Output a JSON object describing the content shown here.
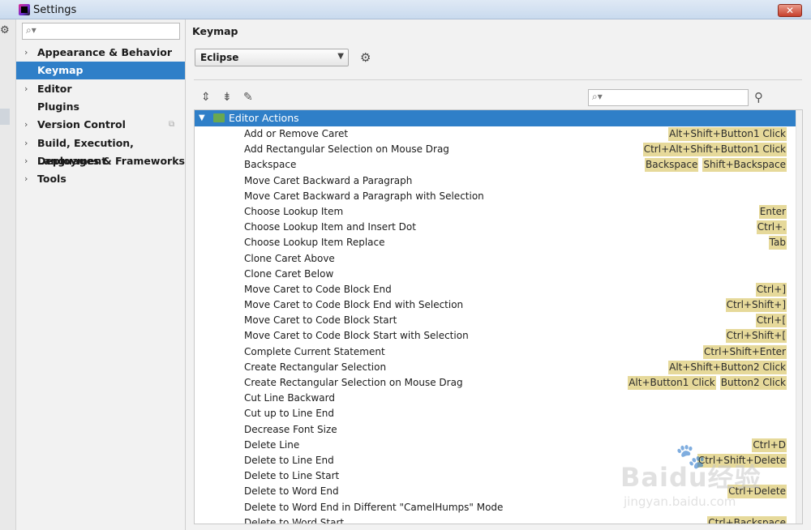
{
  "window": {
    "title": "Settings",
    "close_glyph": "✕"
  },
  "left": {
    "search_placeholder": "",
    "items": [
      {
        "label": "Appearance & Behavior",
        "chevron": "›"
      },
      {
        "label": "Keymap",
        "chevron": ""
      },
      {
        "label": "Editor",
        "chevron": "›"
      },
      {
        "label": "Plugins",
        "chevron": ""
      },
      {
        "label": "Version Control",
        "chevron": "›"
      },
      {
        "label": "Build, Execution, Deployment",
        "chevron": "›"
      },
      {
        "label": "Languages & Frameworks",
        "chevron": "›"
      },
      {
        "label": "Tools",
        "chevron": "›"
      }
    ],
    "selected_index": 1
  },
  "main": {
    "title": "Keymap",
    "scheme": "Eclipse",
    "group": "Editor Actions",
    "actions": [
      {
        "name": "Add or Remove Caret",
        "keys": [
          "Alt+Shift+Button1 Click"
        ]
      },
      {
        "name": "Add Rectangular Selection on Mouse Drag",
        "keys": [
          "Ctrl+Alt+Shift+Button1 Click"
        ]
      },
      {
        "name": "Backspace",
        "keys": [
          "Backspace",
          "Shift+Backspace"
        ]
      },
      {
        "name": "Move Caret Backward a Paragraph",
        "keys": []
      },
      {
        "name": "Move Caret Backward a Paragraph with Selection",
        "keys": []
      },
      {
        "name": "Choose Lookup Item",
        "keys": [
          "Enter"
        ]
      },
      {
        "name": "Choose Lookup Item and Insert Dot",
        "keys": [
          "Ctrl+."
        ]
      },
      {
        "name": "Choose Lookup Item Replace",
        "keys": [
          "Tab"
        ]
      },
      {
        "name": "Clone Caret Above",
        "keys": []
      },
      {
        "name": "Clone Caret Below",
        "keys": []
      },
      {
        "name": "Move Caret to Code Block End",
        "keys": [
          "Ctrl+]"
        ]
      },
      {
        "name": "Move Caret to Code Block End with Selection",
        "keys": [
          "Ctrl+Shift+]"
        ]
      },
      {
        "name": "Move Caret to Code Block Start",
        "keys": [
          "Ctrl+["
        ]
      },
      {
        "name": "Move Caret to Code Block Start with Selection",
        "keys": [
          "Ctrl+Shift+["
        ]
      },
      {
        "name": "Complete Current Statement",
        "keys": [
          "Ctrl+Shift+Enter"
        ]
      },
      {
        "name": "Create Rectangular Selection",
        "keys": [
          "Alt+Shift+Button2 Click"
        ]
      },
      {
        "name": "Create Rectangular Selection on Mouse Drag",
        "keys": [
          "Alt+Button1 Click",
          "Button2 Click"
        ]
      },
      {
        "name": "Cut Line Backward",
        "keys": []
      },
      {
        "name": "Cut up to Line End",
        "keys": []
      },
      {
        "name": "Decrease Font Size",
        "keys": []
      },
      {
        "name": "Delete Line",
        "keys": [
          "Ctrl+D"
        ]
      },
      {
        "name": "Delete to Line End",
        "keys": [
          "Ctrl+Shift+Delete"
        ]
      },
      {
        "name": "Delete to Line Start",
        "keys": []
      },
      {
        "name": "Delete to Word End",
        "keys": [
          "Ctrl+Delete"
        ]
      },
      {
        "name": "Delete to Word End in Different \"CamelHumps\" Mode",
        "keys": []
      },
      {
        "name": "Delete to Word Start",
        "keys": [
          "Ctrl+Backspace"
        ]
      }
    ]
  },
  "watermark": {
    "main": "Baidu经验",
    "sub": "jingyan.baidu.com"
  },
  "colors": {
    "selection": "#2f7fc8",
    "shortcut_bg": "#e6d99a"
  }
}
